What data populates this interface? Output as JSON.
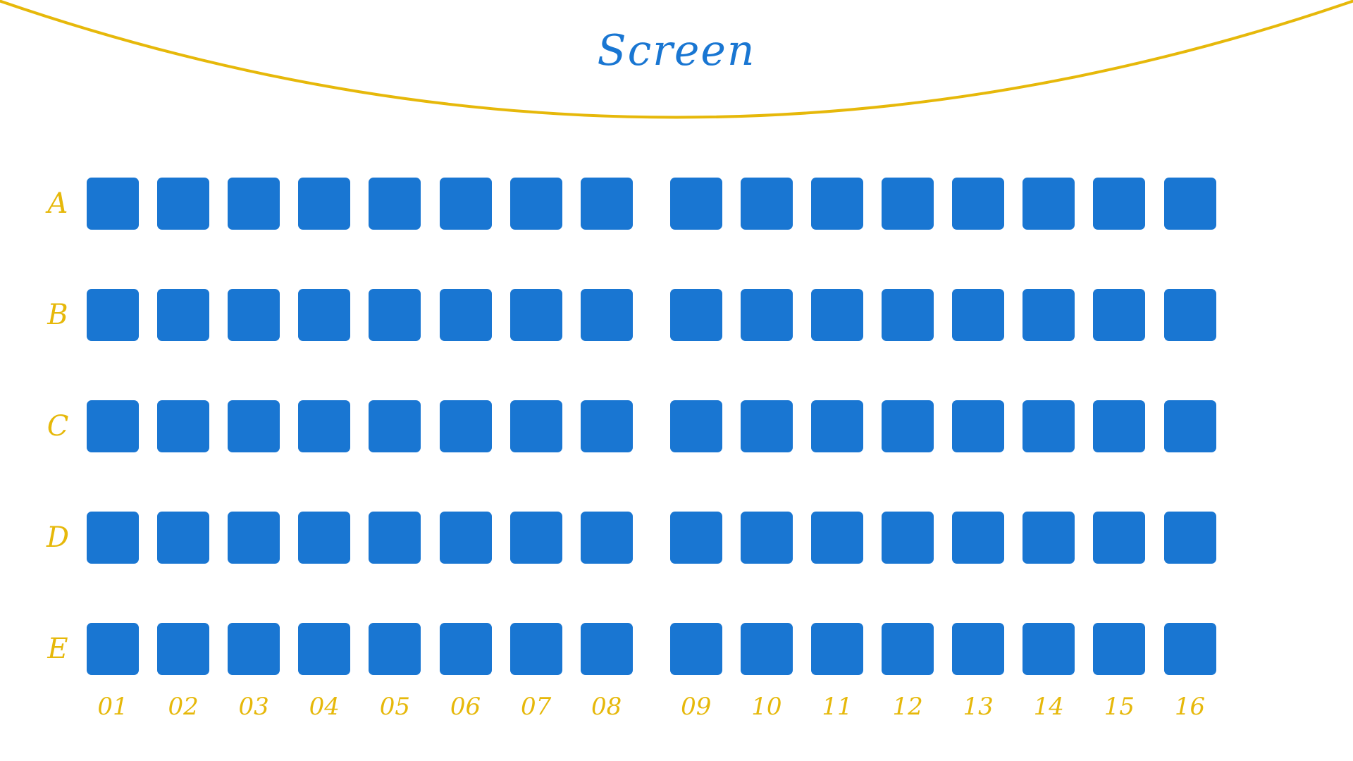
{
  "screen": {
    "label": "Screen"
  },
  "colors": {
    "seat": "#1976d2",
    "accent": "#e6b80a",
    "screen_text": "#1976d2",
    "background": "#ffffff"
  },
  "rows": [
    "A",
    "B",
    "C",
    "D",
    "E"
  ],
  "columns": [
    "01",
    "02",
    "03",
    "04",
    "05",
    "06",
    "07",
    "08",
    "09",
    "10",
    "11",
    "12",
    "13",
    "14",
    "15",
    "16"
  ],
  "seat_state": "available"
}
